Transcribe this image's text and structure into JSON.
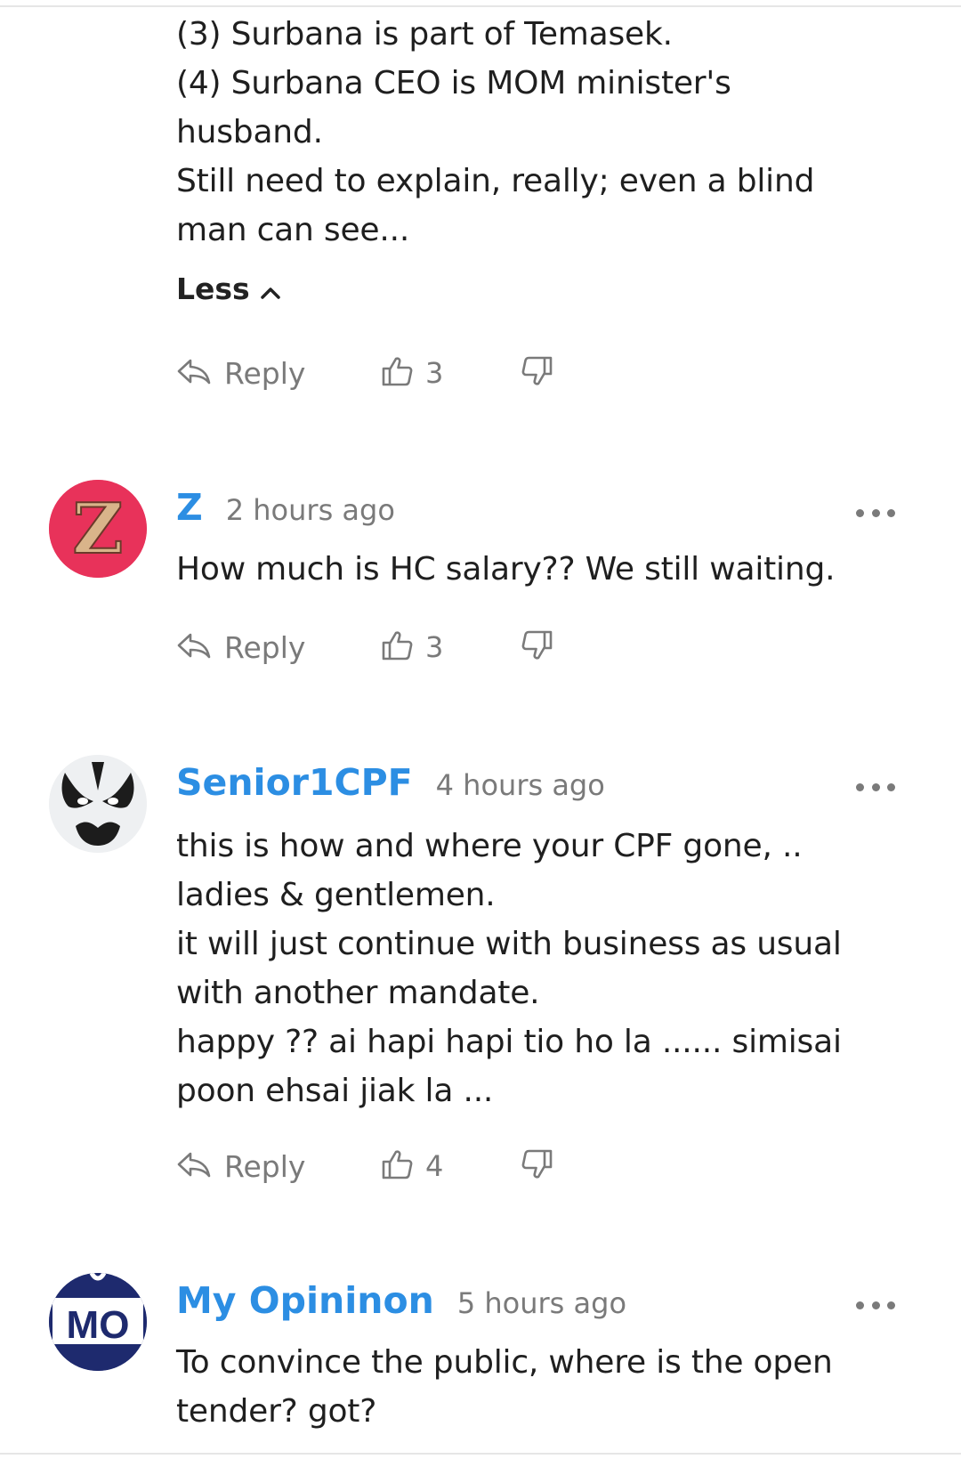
{
  "top_comment": {
    "lines": [
      "(3) Surbana is part of Temasek.",
      "(4) Surbana CEO is MOM minister's",
      "husband.",
      "Still need to explain, really; even a blind",
      "man can see..."
    ],
    "less_label": "Less",
    "reply_label": "Reply",
    "likes": "3"
  },
  "comments": [
    {
      "avatar_text": "Z",
      "author": "Z",
      "time": "2 hours ago",
      "lines": [
        "How much is HC salary?? We still waiting."
      ],
      "reply_label": "Reply",
      "likes": "3"
    },
    {
      "author": "Senior1CPF",
      "time": "4 hours ago",
      "lines": [
        "this is how and where your CPF gone, ..",
        "ladies & gentlemen.",
        "it will just continue with business as usual",
        "with another mandate.",
        "happy ?? ai hapi hapi tio ho la ...... simisai",
        "poon ehsai jiak la ..."
      ],
      "reply_label": "Reply",
      "likes": "4"
    },
    {
      "avatar_text": "MO",
      "author": "My Opininon",
      "time": "5 hours ago",
      "lines": [
        "To convince the public, where is the open",
        "tender? got?"
      ]
    }
  ],
  "colors": {
    "author_link": "#2c8ee3",
    "muted_text": "#7a7a7a",
    "body_text": "#1f1f1f",
    "avatar_z_bg": "#e8325a",
    "avatar_mo_bg": "#1e2a6e"
  },
  "icons": [
    "chevron-up-icon",
    "reply-arrow-icon",
    "thumbs-up-icon",
    "thumbs-down-icon",
    "more-dots-icon"
  ]
}
